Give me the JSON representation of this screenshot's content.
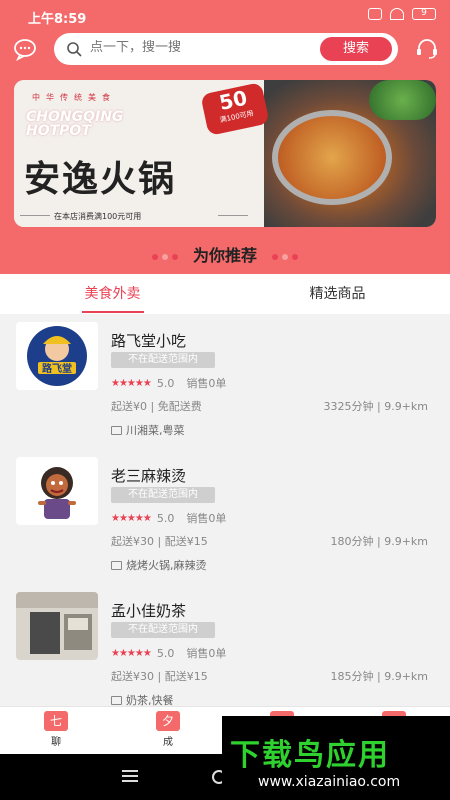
{
  "status_bar": {
    "time": "上午8:59",
    "battery": "9"
  },
  "header": {
    "search_placeholder": "点一下，搜一搜",
    "search_button": "搜索"
  },
  "banner": {
    "subtitle": "中华传统美食",
    "en_line1": "CHONGQING",
    "en_line2": "HOTPOT",
    "title": "安逸火锅",
    "badge_value": "50",
    "badge_sub": "满100可用",
    "note": "在本店消费满100元可用"
  },
  "recommend": {
    "title": "为你推荐"
  },
  "tabs": [
    {
      "label": "美食外卖"
    },
    {
      "label": "精选商品"
    }
  ],
  "stores": [
    {
      "name": "路飞堂小吃",
      "logo_text": "路飞堂",
      "status": "不在配送范围内",
      "rating": "5.0",
      "sales": "销售0单",
      "delivery": "起送¥0 | 免配送费",
      "time_distance": "3325分钟 | 9.9+km",
      "cuisine": "川湘菜,粤菜"
    },
    {
      "name": "老三麻辣烫",
      "status": "不在配送范围内",
      "rating": "5.0",
      "sales": "销售0单",
      "delivery": "起送¥30 | 配送¥15",
      "time_distance": "180分钟 | 9.9+km",
      "cuisine": "烧烤火锅,麻辣烫"
    },
    {
      "name": "孟小佳奶茶",
      "status": "不在配送范围内",
      "rating": "5.0",
      "sales": "销售0单",
      "delivery": "起送¥30 | 配送¥15",
      "time_distance": "185分钟 | 9.9+km",
      "cuisine": "奶茶,快餐"
    }
  ],
  "bottom_nav": [
    {
      "glyph": "七",
      "label": "聊"
    },
    {
      "glyph": "夕",
      "label": "成"
    }
  ],
  "watermark": {
    "title": "下载鸟应用",
    "url": "www.xiazainiao.com"
  },
  "colors": {
    "brand": "#f46a6a",
    "accent": "#e94254",
    "watermark_green": "#2fd12f"
  }
}
